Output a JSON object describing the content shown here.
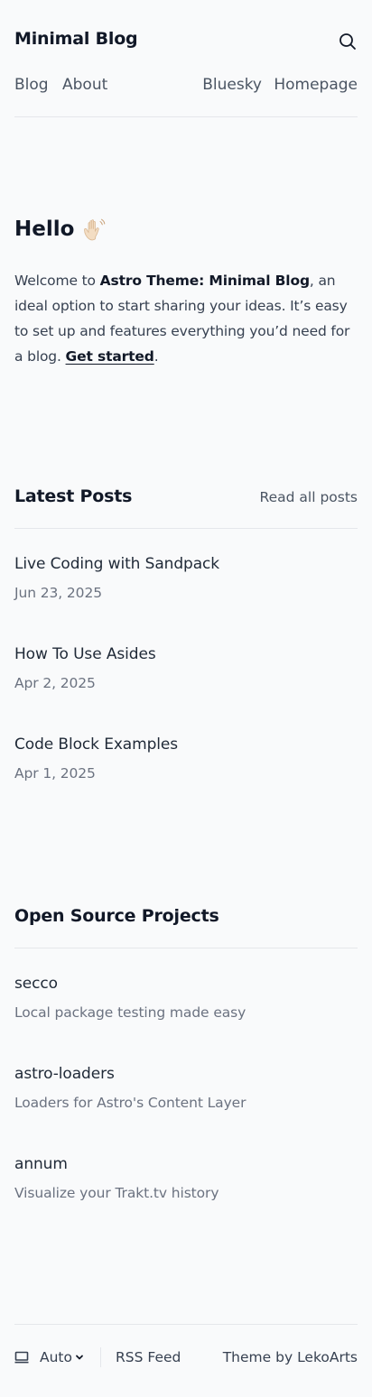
{
  "header": {
    "site_title": "Minimal Blog",
    "nav": {
      "blog": "Blog",
      "about": "About",
      "bluesky": "Bluesky",
      "homepage": "Homepage"
    }
  },
  "hero": {
    "title": "Hello",
    "text_prefix": "Welcome to ",
    "text_strong": "Astro Theme: Minimal Blog",
    "text_middle": ", an ideal option to start sharing your ideas. It’s easy to set up and features everything you’d need for a blog. ",
    "link_label": "Get started",
    "text_suffix": "."
  },
  "latest_posts": {
    "heading": "Latest Posts",
    "read_all_label": "Read all posts",
    "items": [
      {
        "title": "Live Coding with Sandpack",
        "date": "Jun 23, 2025"
      },
      {
        "title": "How To Use Asides",
        "date": "Apr 2, 2025"
      },
      {
        "title": "Code Block Examples",
        "date": "Apr 1, 2025"
      }
    ]
  },
  "projects": {
    "heading": "Open Source Projects",
    "items": [
      {
        "name": "secco",
        "description": "Local package testing made easy"
      },
      {
        "name": "astro-loaders",
        "description": "Loaders for Astro's Content Layer"
      },
      {
        "name": "annum",
        "description": "Visualize your Trakt.tv history"
      }
    ]
  },
  "footer": {
    "theme_label": "Auto",
    "rss_label": "RSS Feed",
    "credit_prefix": "Theme by ",
    "credit_link": "LekoArts"
  },
  "icons": {
    "search": "search-icon",
    "wave": "waving-hand-icon",
    "monitor": "monitor-icon",
    "chevron": "chevron-down-icon"
  },
  "colors": {
    "background": "#f9fafb",
    "text": "#1f2937",
    "muted": "#6b7280",
    "border": "#e5e7eb"
  }
}
